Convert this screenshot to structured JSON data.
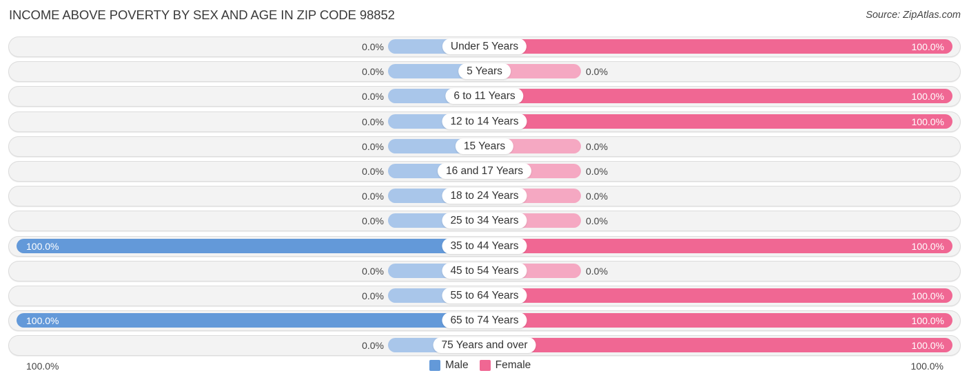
{
  "title": "INCOME ABOVE POVERTY BY SEX AND AGE IN ZIP CODE 98852",
  "source": "Source: ZipAtlas.com",
  "colors": {
    "male": "#6399d9",
    "male_light": "#a9c6ea",
    "female": "#f06793",
    "female_light": "#f5a8c2"
  },
  "legend": {
    "male": "Male",
    "female": "Female"
  },
  "axis": {
    "left": "100.0%",
    "right": "100.0%"
  },
  "chart_data": {
    "type": "bar",
    "orientation": "horizontal-diverging",
    "title": "INCOME ABOVE POVERTY BY SEX AND AGE IN ZIP CODE 98852",
    "xlim": [
      -100,
      100
    ],
    "legend_position": "bottom-center",
    "categories": [
      "Under 5 Years",
      "5 Years",
      "6 to 11 Years",
      "12 to 14 Years",
      "15 Years",
      "16 and 17 Years",
      "18 to 24 Years",
      "25 to 34 Years",
      "35 to 44 Years",
      "45 to 54 Years",
      "55 to 64 Years",
      "65 to 74 Years",
      "75 Years and over"
    ],
    "series": [
      {
        "name": "Male",
        "values": [
          0,
          0,
          0,
          0,
          0,
          0,
          0,
          0,
          100,
          0,
          0,
          100,
          0
        ],
        "labels": [
          "0.0%",
          "0.0%",
          "0.0%",
          "0.0%",
          "0.0%",
          "0.0%",
          "0.0%",
          "0.0%",
          "100.0%",
          "0.0%",
          "0.0%",
          "100.0%",
          "0.0%"
        ]
      },
      {
        "name": "Female",
        "values": [
          100,
          0,
          100,
          100,
          0,
          0,
          0,
          0,
          100,
          0,
          100,
          100,
          100
        ],
        "labels": [
          "100.0%",
          "0.0%",
          "100.0%",
          "100.0%",
          "0.0%",
          "0.0%",
          "0.0%",
          "0.0%",
          "100.0%",
          "0.0%",
          "100.0%",
          "100.0%",
          "100.0%"
        ]
      }
    ]
  }
}
